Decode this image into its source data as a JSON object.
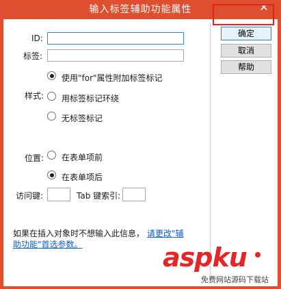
{
  "window": {
    "title": "输入标签辅助功能属性",
    "close_glyph": "✕"
  },
  "fields": {
    "id_label": "ID:",
    "id_value": "",
    "label_label": "标签:",
    "label_value": ""
  },
  "style_group": {
    "label": "样式:",
    "options": [
      {
        "label": "使用\"for\"属性附加标签标记",
        "checked": true
      },
      {
        "label": "用标签标记环绕",
        "checked": false
      },
      {
        "label": "无标签标记",
        "checked": false
      }
    ]
  },
  "position_group": {
    "label": "位置:",
    "options": [
      {
        "label": "在表单项前",
        "checked": false
      },
      {
        "label": "在表单项后",
        "checked": true
      }
    ]
  },
  "access_key": {
    "label": "访问键:",
    "value": ""
  },
  "tab_index": {
    "label": "Tab 键索引:",
    "value": ""
  },
  "hint": {
    "text": "如果在插入对象时不想输入此信息，",
    "link_line1": "请更改\"辅",
    "link_line2": "助功能\"首选参数。"
  },
  "buttons": {
    "ok": "确定",
    "cancel": "取消",
    "help": "帮助"
  },
  "watermark": {
    "text": "aspku",
    "sub": "免费网站源码下载站"
  },
  "colors": {
    "titlebar": "#dd4f2f",
    "highlight": "#e11f1f",
    "link": "#0b5fc2"
  }
}
